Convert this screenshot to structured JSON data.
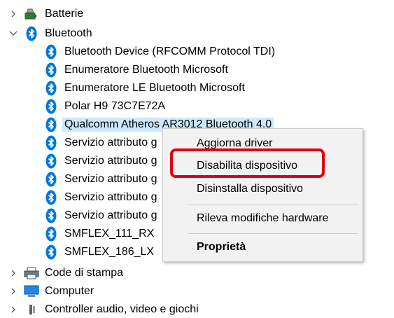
{
  "tree": {
    "batterie": "Batterie",
    "bluetooth": "Bluetooth",
    "bluetooth_children": [
      "Bluetooth Device (RFCOMM Protocol TDI)",
      "Enumeratore Bluetooth Microsoft",
      "Enumeratore LE Bluetooth Microsoft",
      "Polar H9 73C7E72A",
      "Qualcomm Atheros AR3012 Bluetooth 4.0",
      "Servizio attributo g",
      "Servizio attributo g",
      "Servizio attributo g",
      "Servizio attributo g",
      "Servizio attributo g",
      "SMFLEX_111_RX",
      "SMFLEX_186_LX"
    ],
    "code_di_stampa": "Code di stampa",
    "computer": "Computer",
    "controller_audio": "Controller audio, video e giochi"
  },
  "context_menu": {
    "update_driver": "Aggiorna driver",
    "disable_device": "Disabilita dispositivo",
    "uninstall_device": "Disinstalla dispositivo",
    "scan_hardware": "Rileva modifiche hardware",
    "properties": "Proprietà"
  },
  "colors": {
    "bluetooth_blue": "#0078d7",
    "selection": "#cce8ff",
    "highlight_red": "#e0000f",
    "menu_bg": "#f2f2f2"
  }
}
